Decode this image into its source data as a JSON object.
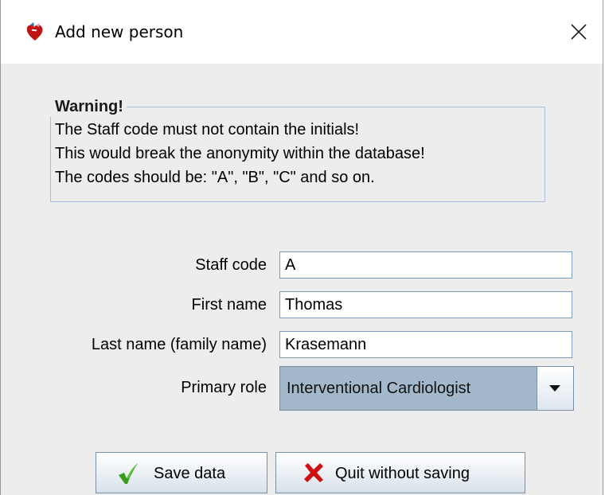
{
  "window": {
    "title": "Add new person",
    "icon": "heart-app-icon",
    "close_icon": "close-icon"
  },
  "warning": {
    "legend": "Warning!",
    "lines": [
      "The Staff code must not contain the initials!",
      "This would break the anonymity within the database!",
      "The codes should be: \"A\", \"B\", \"C\" and so on."
    ]
  },
  "form": {
    "staff_code": {
      "label": "Staff code",
      "value": "A"
    },
    "first_name": {
      "label": "First name",
      "value": "Thomas"
    },
    "last_name": {
      "label": "Last name (family name)",
      "value": "Krasemann"
    },
    "primary_role": {
      "label": "Primary role",
      "selected": "Interventional Cardiologist",
      "arrow_icon": "dropdown-arrow-icon"
    }
  },
  "buttons": {
    "save": {
      "label": "Save data",
      "icon": "checkmark-icon",
      "icon_color": "#3a9a1a"
    },
    "quit": {
      "label": "Quit without saving",
      "icon": "red-x-icon",
      "icon_color": "#d01010"
    }
  }
}
